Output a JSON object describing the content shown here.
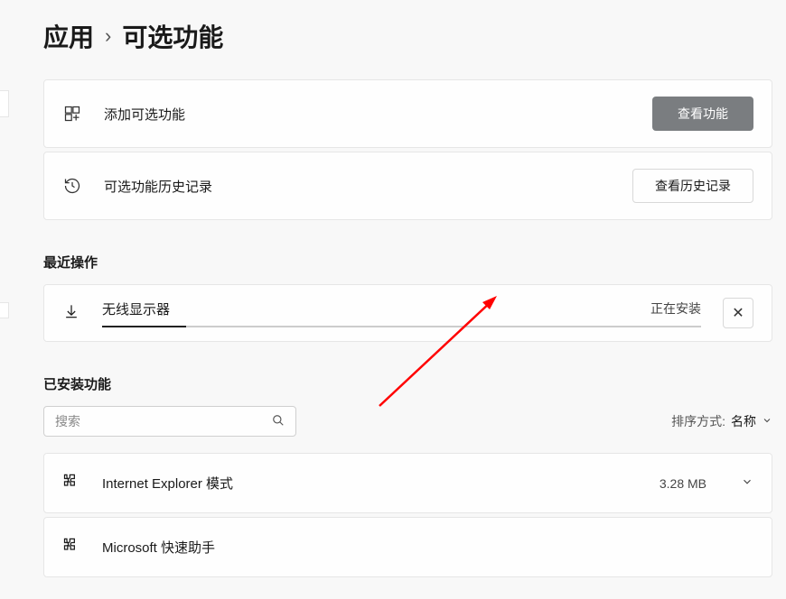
{
  "breadcrumb": {
    "parent": "应用",
    "current": "可选功能"
  },
  "addFeature": {
    "label": "添加可选功能",
    "button": "查看功能"
  },
  "history": {
    "label": "可选功能历史记录",
    "button": "查看历史记录"
  },
  "recentSection": {
    "title": "最近操作",
    "item": {
      "name": "无线显示器",
      "status": "正在安装"
    }
  },
  "installedSection": {
    "title": "已安装功能",
    "searchPlaceholder": "搜索",
    "sortLabel": "排序方式:",
    "sortValue": "名称",
    "items": [
      {
        "name": "Internet Explorer 模式",
        "size": "3.28 MB"
      },
      {
        "name": "Microsoft 快速助手",
        "size": ""
      }
    ]
  }
}
